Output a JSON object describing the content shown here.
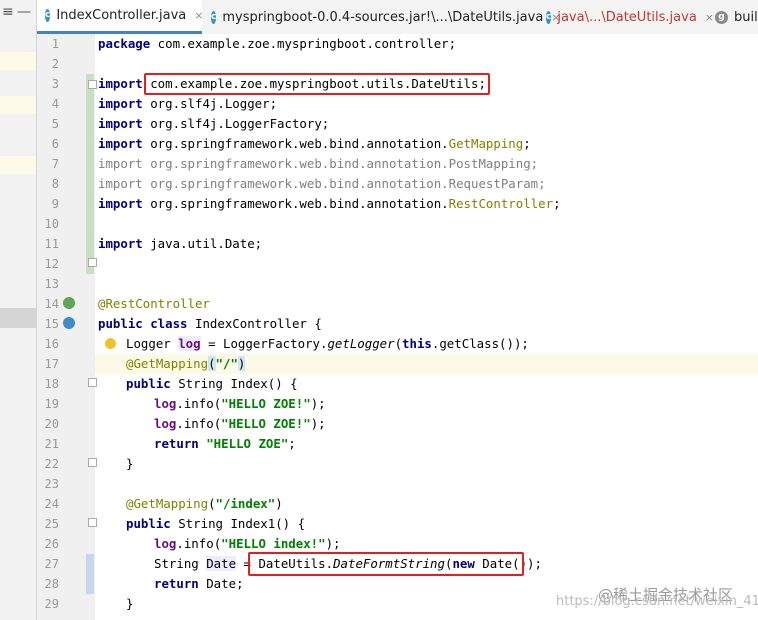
{
  "tabs": [
    {
      "label": "IndexController.java",
      "close": "×"
    },
    {
      "label": "myspringboot-0.0.4-sources.jar!\\...\\DateUtils.java",
      "close": "×"
    },
    {
      "label": "java\\...\\DateUtils.java",
      "close": "×"
    },
    {
      "label": "build"
    }
  ],
  "toolbar": {
    "collapse": "≡",
    "minimize": "—"
  },
  "lines": {
    "n1": "1",
    "n2": "2",
    "n3": "3",
    "n4": "4",
    "n5": "5",
    "n6": "6",
    "n7": "7",
    "n8": "8",
    "n9": "9",
    "n10": "10",
    "n11": "11",
    "n12": "12",
    "n13": "13",
    "n14": "14",
    "n15": "15",
    "n16": "16",
    "n17": "17",
    "n18": "18",
    "n19": "19",
    "n20": "20",
    "n21": "21",
    "n22": "22",
    "n23": "23",
    "n24": "24",
    "n25": "25",
    "n26": "26",
    "n27": "27",
    "n28": "28",
    "n29": "29"
  },
  "code": {
    "l1_kw": "package",
    "l1_rest": " com.example.zoe.myspringboot.controller;",
    "import": "import",
    "l3": " com.example.zoe.myspringboot.utils.DateUtils;",
    "l4": " org.slf4j.Logger;",
    "l5": " org.slf4j.LoggerFactory;",
    "l6_a": " org.springframework.web.bind.annotation.",
    "l6_b": "GetMapping",
    "semi": ";",
    "l7": " org.springframework.web.bind.annotation.PostMapping;",
    "l8": " org.springframework.web.bind.annotation.RequestParam;",
    "l9_a": " org.springframework.web.bind.annotation.",
    "l9_b": "RestController",
    "l11": " java.util.Date;",
    "l14": "@RestController",
    "l15_kw": "public class",
    "l15_rest": " IndexController {",
    "l16_a": "Logger ",
    "l16_log": "log",
    "l16_b": " = LoggerFactory.",
    "l16_m": "getLogger",
    "l16_c": "(",
    "l16_this": "this",
    "l16_d": ".getClass());",
    "l17_ann": "@GetMapping",
    "l17_open": "(",
    "l17_str": "\"/\"",
    "l17_close": ")",
    "l18_kw": "public",
    "l18_rest": " String Index() {",
    "log": "log",
    "info_open": ".info(",
    "info_close": ");",
    "l19_str": "\"HELLO ZOE!\"",
    "l20_str": "\"HELLO ZOE!\"",
    "ret": "return",
    "l21_str": " \"HELLO ZOE\"",
    "brace": "}",
    "l24_ann": "@GetMapping",
    "l24_open": "(",
    "l24_str": "\"/index\"",
    "l24_close": ")",
    "l25_kw": "public",
    "l25_rest": " String Index1() {",
    "l26_str": "\"HELLO index!\"",
    "l27_a": "String ",
    "l27_var": "Date",
    "l27_b": " = ",
    "l27_c": "DateUtils.",
    "l27_m": "DateFormtString",
    "l27_d": "(",
    "l27_new": "new",
    "l27_e": " Date());",
    "l28_rest": " Date;",
    "l29": "}"
  },
  "watermark": {
    "brand": "@稀土掘金技术社区",
    "url": "https://blog.csdn.net/weixin_41"
  },
  "colors": {
    "keyword": "#000080",
    "string": "#008000",
    "annotation": "#808000",
    "field": "#660e7a",
    "highlight_box": "#e02020"
  }
}
